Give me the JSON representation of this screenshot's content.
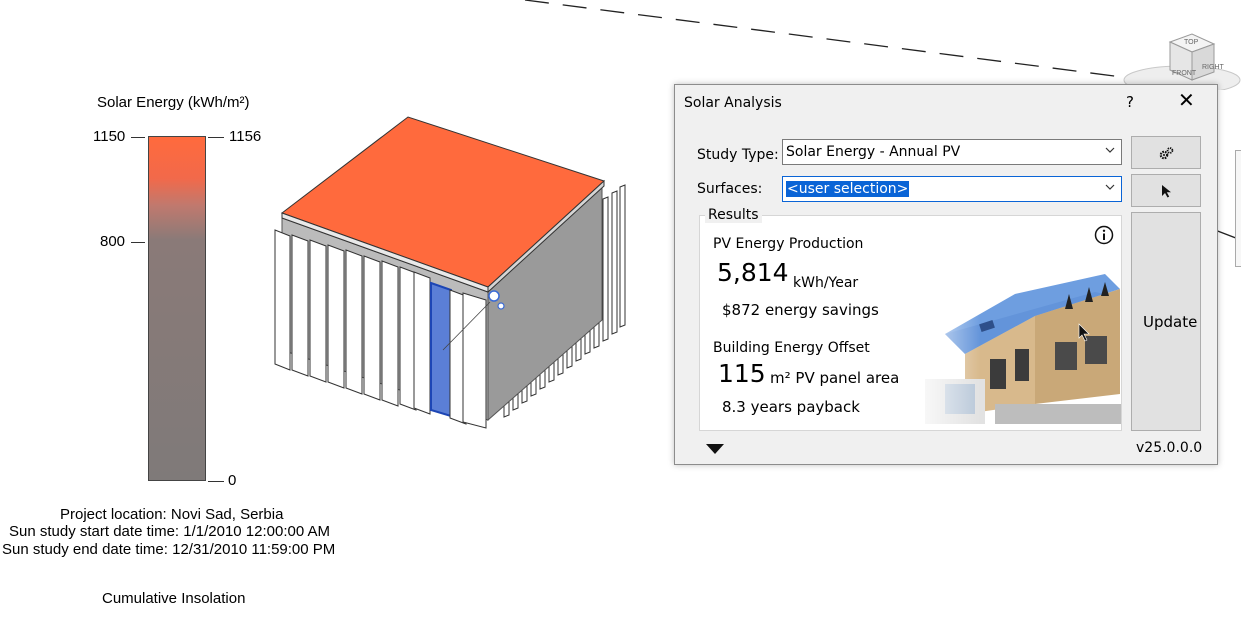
{
  "legend": {
    "title": "Solar Energy (kWh/m²)",
    "label_1150": "1150",
    "label_1156": "1156",
    "label_800": "800",
    "label_0": "0"
  },
  "study_info": {
    "location": "Project location: Novi Sad, Serbia",
    "start": "Sun study start date time: 1/1/2010 12:00:00 AM",
    "end": "Sun study end date time:  12/31/2010 11:59:00 PM",
    "mode": "Cumulative Insolation"
  },
  "viewcube": {
    "top": "TOP",
    "front": "FRONT",
    "right": "RIGHT"
  },
  "dialog": {
    "title": "Solar Analysis",
    "help": "?",
    "close": "✕",
    "study_type_label": "Study Type:",
    "study_type_value": "Solar Energy - Annual PV",
    "surfaces_label": "Surfaces:",
    "surfaces_value": "<user selection>",
    "results_label": "Results",
    "pv_heading": "PV Energy Production",
    "pv_value": "5,814",
    "pv_unit": "kWh/Year",
    "savings": "$872 energy savings",
    "offset_heading": "Building Energy Offset",
    "area_value": "115",
    "area_unit": "m² PV panel area",
    "payback": "8.3 years payback",
    "update_label": "Update",
    "version": "v25.0.0.0"
  },
  "colors": {
    "accent": "#0a64d6",
    "roof": "#ff6a3d",
    "legend_low": "#7f7a79"
  }
}
